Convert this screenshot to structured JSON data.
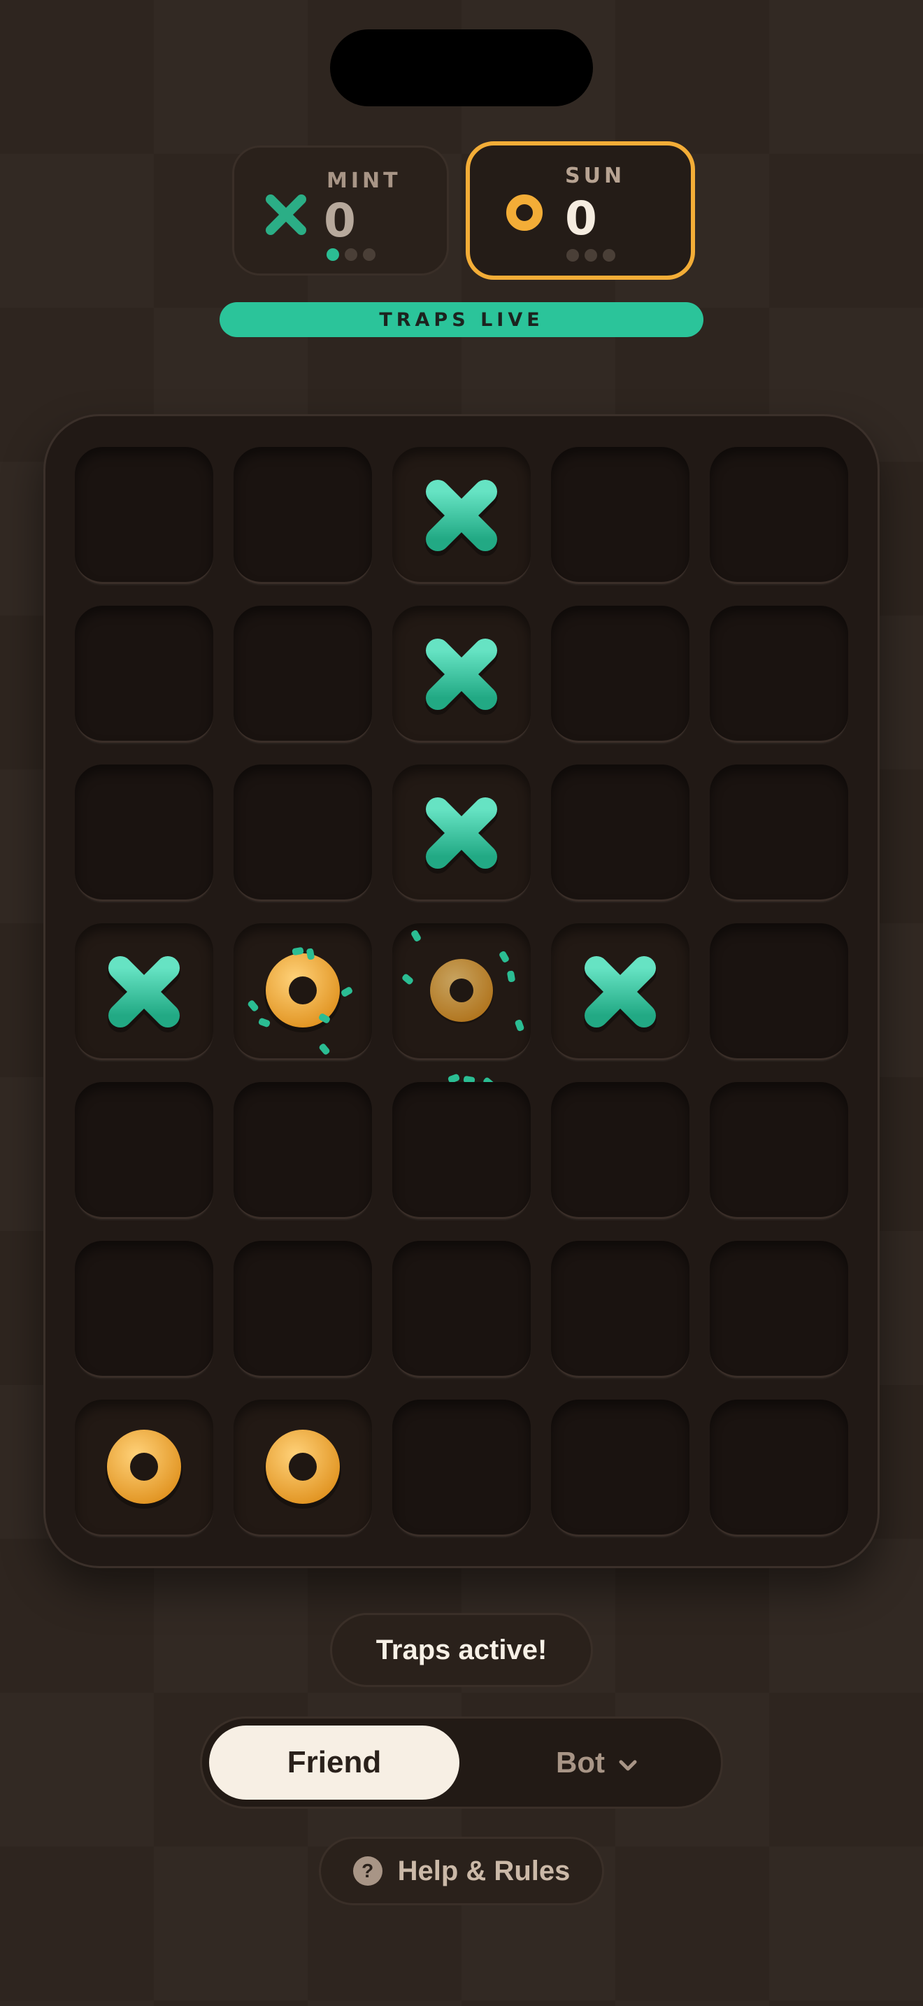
{
  "players": {
    "mint": {
      "name": "MINT",
      "score": "0",
      "icon": "x-icon",
      "color": "#2bbd93",
      "round_dots": [
        true,
        false,
        false
      ]
    },
    "sun": {
      "name": "SUN",
      "score": "0",
      "icon": "o-ring-icon",
      "color": "#f3ad37",
      "round_dots": [
        false,
        false,
        false
      ],
      "active": true
    }
  },
  "banner": {
    "label": "TRAPS LIVE"
  },
  "board": {
    "rows": 7,
    "cols": 5,
    "cells": [
      [
        "",
        "",
        "X",
        "",
        ""
      ],
      [
        "",
        "",
        "X",
        "",
        ""
      ],
      [
        "",
        "",
        "X",
        "",
        ""
      ],
      [
        "X",
        "O-trapped",
        "O-ghost",
        "X",
        ""
      ],
      [
        "",
        "",
        "",
        "",
        ""
      ],
      [
        "",
        "",
        "",
        "",
        ""
      ],
      [
        "O",
        "O",
        "",
        "",
        ""
      ]
    ]
  },
  "status": {
    "text": "Traps active!"
  },
  "mode_toggle": {
    "friend_label": "Friend",
    "bot_label": "Bot",
    "selected": "Friend"
  },
  "help": {
    "label": "Help & Rules",
    "icon": "question-icon"
  }
}
